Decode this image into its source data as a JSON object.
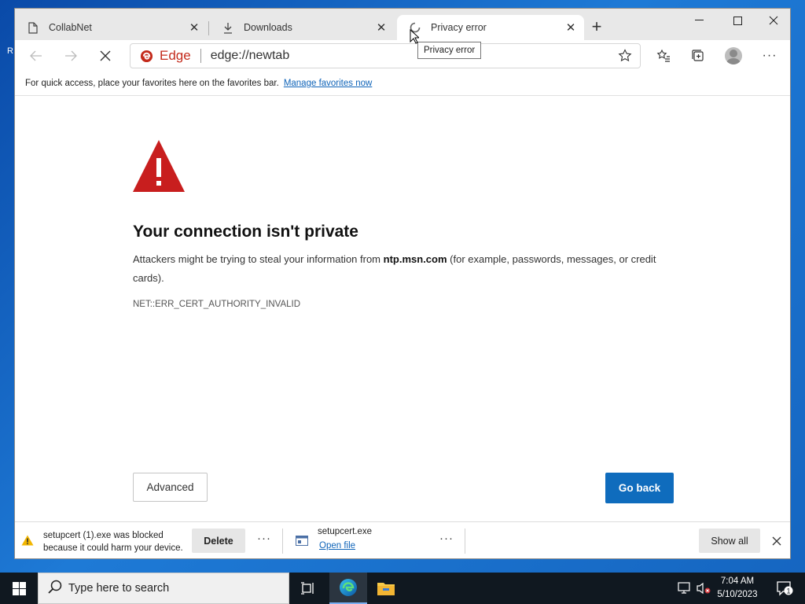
{
  "desktop": {
    "edge_char": "R"
  },
  "browser": {
    "tabs": [
      {
        "label": "CollabNet",
        "icon": "page-icon"
      },
      {
        "label": "Downloads",
        "icon": "download-icon"
      },
      {
        "label": "Privacy error",
        "icon": "loading-spinner-icon",
        "active": true
      }
    ],
    "tooltip": "Privacy error",
    "omnibox": {
      "brand": "Edge",
      "url": "edge://newtab"
    },
    "favorites_bar": {
      "message": "For quick access, place your favorites here on the favorites bar.",
      "link": "Manage favorites now"
    }
  },
  "error_page": {
    "title": "Your connection isn't private",
    "body_before": "Attackers might be trying to steal your information from ",
    "host": "ntp.msn.com",
    "body_after": " (for example, passwords, messages, or credit cards).",
    "code": "NET::ERR_CERT_AUTHORITY_INVALID",
    "advanced_label": "Advanced",
    "back_label": "Go back",
    "colors": {
      "warning_red": "#c81e1e",
      "primary_blue": "#0f6cbd"
    }
  },
  "downloads_bar": {
    "blocked_line1": "setupcert (1).exe was blocked",
    "blocked_line2": "because it could harm your device.",
    "delete_label": "Delete",
    "more_label": "···",
    "file_name": "setupcert.exe",
    "open_label": "Open file",
    "show_all_label": "Show all"
  },
  "taskbar": {
    "search_placeholder": "Type here to search",
    "time": "7:04 AM",
    "date": "5/10/2023",
    "notification_count": "1"
  }
}
